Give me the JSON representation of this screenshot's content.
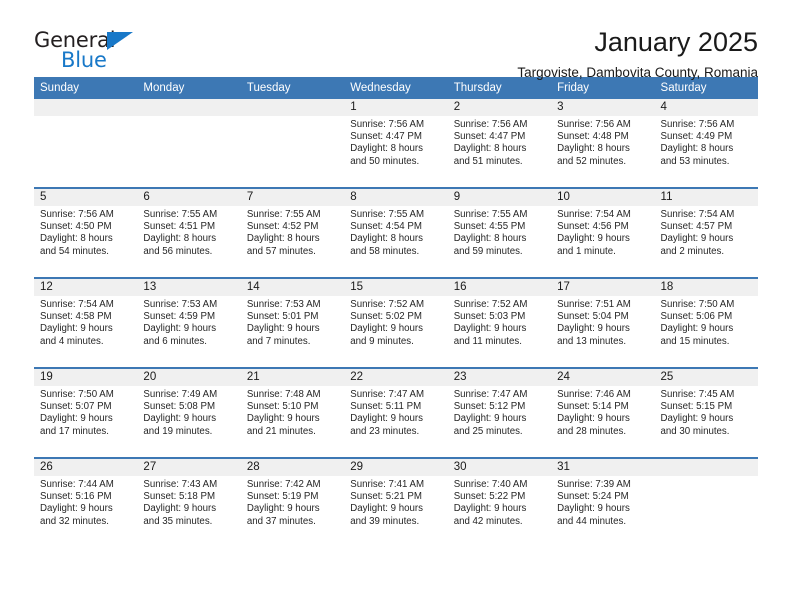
{
  "brand": {
    "name_top": "General",
    "name_bottom": "Blue",
    "triangle_color": "#1878c8"
  },
  "header": {
    "title": "January 2025",
    "subtitle": "Targoviste, Dambovita County, Romania"
  },
  "colors": {
    "header_blue": "#3d78b4",
    "daynum_band": "#f0f0f0",
    "text": "#1a1a1a"
  },
  "weekday_headers": [
    "Sunday",
    "Monday",
    "Tuesday",
    "Wednesday",
    "Thursday",
    "Friday",
    "Saturday"
  ],
  "labels": {
    "sunrise": "Sunrise:",
    "sunset": "Sunset:",
    "daylight": "Daylight:"
  },
  "weeks": [
    [
      {
        "day": "",
        "empty": true
      },
      {
        "day": "",
        "empty": true
      },
      {
        "day": "",
        "empty": true
      },
      {
        "day": "1",
        "sunrise": "Sunrise: 7:56 AM",
        "sunset": "Sunset: 4:47 PM",
        "daylight1": "Daylight: 8 hours",
        "daylight2": "and 50 minutes."
      },
      {
        "day": "2",
        "sunrise": "Sunrise: 7:56 AM",
        "sunset": "Sunset: 4:47 PM",
        "daylight1": "Daylight: 8 hours",
        "daylight2": "and 51 minutes."
      },
      {
        "day": "3",
        "sunrise": "Sunrise: 7:56 AM",
        "sunset": "Sunset: 4:48 PM",
        "daylight1": "Daylight: 8 hours",
        "daylight2": "and 52 minutes."
      },
      {
        "day": "4",
        "sunrise": "Sunrise: 7:56 AM",
        "sunset": "Sunset: 4:49 PM",
        "daylight1": "Daylight: 8 hours",
        "daylight2": "and 53 minutes."
      }
    ],
    [
      {
        "day": "5",
        "sunrise": "Sunrise: 7:56 AM",
        "sunset": "Sunset: 4:50 PM",
        "daylight1": "Daylight: 8 hours",
        "daylight2": "and 54 minutes."
      },
      {
        "day": "6",
        "sunrise": "Sunrise: 7:55 AM",
        "sunset": "Sunset: 4:51 PM",
        "daylight1": "Daylight: 8 hours",
        "daylight2": "and 56 minutes."
      },
      {
        "day": "7",
        "sunrise": "Sunrise: 7:55 AM",
        "sunset": "Sunset: 4:52 PM",
        "daylight1": "Daylight: 8 hours",
        "daylight2": "and 57 minutes."
      },
      {
        "day": "8",
        "sunrise": "Sunrise: 7:55 AM",
        "sunset": "Sunset: 4:54 PM",
        "daylight1": "Daylight: 8 hours",
        "daylight2": "and 58 minutes."
      },
      {
        "day": "9",
        "sunrise": "Sunrise: 7:55 AM",
        "sunset": "Sunset: 4:55 PM",
        "daylight1": "Daylight: 8 hours",
        "daylight2": "and 59 minutes."
      },
      {
        "day": "10",
        "sunrise": "Sunrise: 7:54 AM",
        "sunset": "Sunset: 4:56 PM",
        "daylight1": "Daylight: 9 hours",
        "daylight2": "and 1 minute."
      },
      {
        "day": "11",
        "sunrise": "Sunrise: 7:54 AM",
        "sunset": "Sunset: 4:57 PM",
        "daylight1": "Daylight: 9 hours",
        "daylight2": "and 2 minutes."
      }
    ],
    [
      {
        "day": "12",
        "sunrise": "Sunrise: 7:54 AM",
        "sunset": "Sunset: 4:58 PM",
        "daylight1": "Daylight: 9 hours",
        "daylight2": "and 4 minutes."
      },
      {
        "day": "13",
        "sunrise": "Sunrise: 7:53 AM",
        "sunset": "Sunset: 4:59 PM",
        "daylight1": "Daylight: 9 hours",
        "daylight2": "and 6 minutes."
      },
      {
        "day": "14",
        "sunrise": "Sunrise: 7:53 AM",
        "sunset": "Sunset: 5:01 PM",
        "daylight1": "Daylight: 9 hours",
        "daylight2": "and 7 minutes."
      },
      {
        "day": "15",
        "sunrise": "Sunrise: 7:52 AM",
        "sunset": "Sunset: 5:02 PM",
        "daylight1": "Daylight: 9 hours",
        "daylight2": "and 9 minutes."
      },
      {
        "day": "16",
        "sunrise": "Sunrise: 7:52 AM",
        "sunset": "Sunset: 5:03 PM",
        "daylight1": "Daylight: 9 hours",
        "daylight2": "and 11 minutes."
      },
      {
        "day": "17",
        "sunrise": "Sunrise: 7:51 AM",
        "sunset": "Sunset: 5:04 PM",
        "daylight1": "Daylight: 9 hours",
        "daylight2": "and 13 minutes."
      },
      {
        "day": "18",
        "sunrise": "Sunrise: 7:50 AM",
        "sunset": "Sunset: 5:06 PM",
        "daylight1": "Daylight: 9 hours",
        "daylight2": "and 15 minutes."
      }
    ],
    [
      {
        "day": "19",
        "sunrise": "Sunrise: 7:50 AM",
        "sunset": "Sunset: 5:07 PM",
        "daylight1": "Daylight: 9 hours",
        "daylight2": "and 17 minutes."
      },
      {
        "day": "20",
        "sunrise": "Sunrise: 7:49 AM",
        "sunset": "Sunset: 5:08 PM",
        "daylight1": "Daylight: 9 hours",
        "daylight2": "and 19 minutes."
      },
      {
        "day": "21",
        "sunrise": "Sunrise: 7:48 AM",
        "sunset": "Sunset: 5:10 PM",
        "daylight1": "Daylight: 9 hours",
        "daylight2": "and 21 minutes."
      },
      {
        "day": "22",
        "sunrise": "Sunrise: 7:47 AM",
        "sunset": "Sunset: 5:11 PM",
        "daylight1": "Daylight: 9 hours",
        "daylight2": "and 23 minutes."
      },
      {
        "day": "23",
        "sunrise": "Sunrise: 7:47 AM",
        "sunset": "Sunset: 5:12 PM",
        "daylight1": "Daylight: 9 hours",
        "daylight2": "and 25 minutes."
      },
      {
        "day": "24",
        "sunrise": "Sunrise: 7:46 AM",
        "sunset": "Sunset: 5:14 PM",
        "daylight1": "Daylight: 9 hours",
        "daylight2": "and 28 minutes."
      },
      {
        "day": "25",
        "sunrise": "Sunrise: 7:45 AM",
        "sunset": "Sunset: 5:15 PM",
        "daylight1": "Daylight: 9 hours",
        "daylight2": "and 30 minutes."
      }
    ],
    [
      {
        "day": "26",
        "sunrise": "Sunrise: 7:44 AM",
        "sunset": "Sunset: 5:16 PM",
        "daylight1": "Daylight: 9 hours",
        "daylight2": "and 32 minutes."
      },
      {
        "day": "27",
        "sunrise": "Sunrise: 7:43 AM",
        "sunset": "Sunset: 5:18 PM",
        "daylight1": "Daylight: 9 hours",
        "daylight2": "and 35 minutes."
      },
      {
        "day": "28",
        "sunrise": "Sunrise: 7:42 AM",
        "sunset": "Sunset: 5:19 PM",
        "daylight1": "Daylight: 9 hours",
        "daylight2": "and 37 minutes."
      },
      {
        "day": "29",
        "sunrise": "Sunrise: 7:41 AM",
        "sunset": "Sunset: 5:21 PM",
        "daylight1": "Daylight: 9 hours",
        "daylight2": "and 39 minutes."
      },
      {
        "day": "30",
        "sunrise": "Sunrise: 7:40 AM",
        "sunset": "Sunset: 5:22 PM",
        "daylight1": "Daylight: 9 hours",
        "daylight2": "and 42 minutes."
      },
      {
        "day": "31",
        "sunrise": "Sunrise: 7:39 AM",
        "sunset": "Sunset: 5:24 PM",
        "daylight1": "Daylight: 9 hours",
        "daylight2": "and 44 minutes."
      },
      {
        "day": "",
        "empty": true
      }
    ]
  ]
}
